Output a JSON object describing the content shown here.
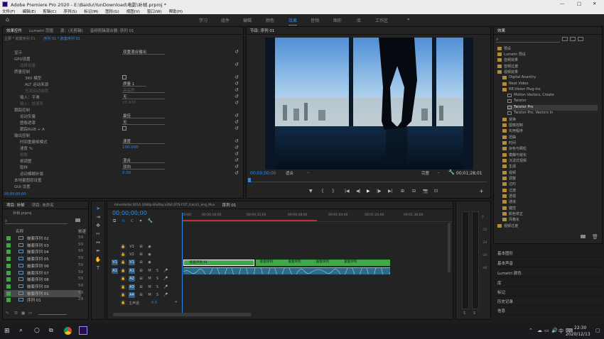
{
  "app": {
    "title": "Adobe Premiere Pro 2020 - E:\\Baidu\\YunDownload\\电影\\补帧.prproj *",
    "window_controls": [
      "—",
      "□",
      "✕"
    ]
  },
  "menu": [
    "文件(F)",
    "编辑(E)",
    "剪辑(C)",
    "序列(S)",
    "标记(M)",
    "图形(G)",
    "视图(V)",
    "窗口(W)",
    "帮助(H)"
  ],
  "workspaces": {
    "items": [
      "学习",
      "组件",
      "编辑",
      "颜色",
      "效果",
      "音频",
      "图形",
      "库",
      "工作区"
    ],
    "active": "效果",
    "more": "»"
  },
  "effect_controls": {
    "tabs": [
      "效果控件",
      "Lumetri 范围",
      "源：(无剪辑)",
      "音频剪辑混合器: 序列 01"
    ],
    "breadcrumb_master": "主要 * 嵌套序列 01",
    "breadcrumb_seq": "序列 01 * 嵌套序列 01",
    "rows": [
      {
        "label": "显示",
        "value": "双重混合输出",
        "type": "dropdown",
        "indent": 1
      },
      {
        "label": "GPU设置",
        "value": "",
        "type": "header",
        "indent": 1
      },
      {
        "label": "选择设备",
        "value": "",
        "type": "dim",
        "indent": 2
      },
      {
        "label": "质量控制",
        "value": "",
        "type": "header",
        "indent": 1
      },
      {
        "label": "360 模型",
        "value": "",
        "type": "check",
        "indent": 3
      },
      {
        "label": "ALT 运动来源",
        "value": "质量 1",
        "type": "dropdown",
        "indent": 3
      },
      {
        "label": "光流运动强度",
        "value": "高品质",
        "type": "dropdown-dim",
        "indent": 3
      },
      {
        "label": "输入：平滑",
        "value": "无",
        "type": "dropdown",
        "indent": 2
      },
      {
        "label": "输入：帧速率",
        "value": "23.976",
        "type": "dim",
        "indent": 2
      },
      {
        "label": "跟踪控制",
        "value": "",
        "type": "header",
        "indent": 1
      },
      {
        "label": "运动矢量",
        "value": "最佳",
        "type": "dropdown",
        "indent": 2
      },
      {
        "label": "图像遮罩",
        "value": "无",
        "type": "dropdown",
        "indent": 2
      },
      {
        "label": "跟踪RGB + A",
        "value": "",
        "type": "check",
        "indent": 2
      },
      {
        "label": "输出控制",
        "value": "",
        "type": "header",
        "indent": 1
      },
      {
        "label": "时间重建帧模式",
        "value": "速度",
        "type": "dropdown",
        "indent": 2
      },
      {
        "label": "速度 %",
        "value": "100.000",
        "type": "blue",
        "indent": 2
      },
      {
        "label": "帧数",
        "value": "",
        "type": "dim",
        "indent": 2
      },
      {
        "label": "帧调整",
        "value": "混合",
        "type": "dropdown",
        "indent": 2
      },
      {
        "label": "取样",
        "value": "双向",
        "type": "dropdown",
        "indent": 2
      },
      {
        "label": "运动模糊补偿",
        "value": "0.00",
        "type": "blue",
        "indent": 2
      },
      {
        "label": "本地量图层设置",
        "value": "",
        "type": "dim",
        "indent": 1
      },
      {
        "label": "GUI 设置",
        "value": "",
        "type": "dim",
        "indent": 1
      }
    ],
    "timecode": "00;00;00;00"
  },
  "program": {
    "tab": "节目: 序列 01",
    "timecode": "00;00;00;00",
    "fit": "适合",
    "quality": "完整",
    "duration": "00;01;28;01",
    "transport": [
      "▼",
      "{",
      "}",
      "|◀",
      "◀|",
      "▶",
      "|▶",
      "▶|",
      "⊞",
      "⊟",
      "📷",
      "⊡"
    ]
  },
  "effects": {
    "tab": "效果",
    "search_placeholder": "",
    "items": [
      {
        "label": "预设",
        "level": 0,
        "sel": false
      },
      {
        "label": "Lumetri 预设",
        "level": 0,
        "sel": false
      },
      {
        "label": "音频效果",
        "level": 0,
        "sel": false
      },
      {
        "label": "音频过渡",
        "level": 0,
        "sel": false
      },
      {
        "label": "视频效果",
        "level": 0,
        "sel": false
      },
      {
        "label": "Digital Anarchy",
        "level": 1,
        "sel": false
      },
      {
        "label": "Neat Video",
        "level": 1,
        "sel": false
      },
      {
        "label": "RE:Vision Plug-ins",
        "level": 1,
        "sel": false
      },
      {
        "label": "Motion Vectors, Create",
        "level": 2,
        "sel": false
      },
      {
        "label": "Twixtor",
        "level": 2,
        "sel": false
      },
      {
        "label": "Twixtor Pro",
        "level": 2,
        "sel": true
      },
      {
        "label": "Twixtor Pro, Vectors In",
        "level": 2,
        "sel": false
      },
      {
        "label": "变换",
        "level": 1,
        "sel": false
      },
      {
        "label": "图像控制",
        "level": 1,
        "sel": false
      },
      {
        "label": "实用程序",
        "level": 1,
        "sel": false
      },
      {
        "label": "扭曲",
        "level": 1,
        "sel": false
      },
      {
        "label": "时间",
        "level": 1,
        "sel": false
      },
      {
        "label": "杂色与颗粒",
        "level": 1,
        "sel": false
      },
      {
        "label": "模糊与锐化",
        "level": 1,
        "sel": false
      },
      {
        "label": "沉浸式视频",
        "level": 1,
        "sel": false
      },
      {
        "label": "生成",
        "level": 1,
        "sel": false
      },
      {
        "label": "视频",
        "level": 1,
        "sel": false
      },
      {
        "label": "调整",
        "level": 1,
        "sel": false
      },
      {
        "label": "过时",
        "level": 1,
        "sel": false
      },
      {
        "label": "过渡",
        "level": 1,
        "sel": false
      },
      {
        "label": "透视",
        "level": 1,
        "sel": false
      },
      {
        "label": "通道",
        "level": 1,
        "sel": false
      },
      {
        "label": "键控",
        "level": 1,
        "sel": false
      },
      {
        "label": "颜色校正",
        "level": 1,
        "sel": false
      },
      {
        "label": "风格化",
        "level": 1,
        "sel": false
      },
      {
        "label": "视频过渡",
        "level": 0,
        "sel": false
      }
    ]
  },
  "side_panels": [
    "基本图形",
    "基本声音",
    "Lumetri 颜色",
    "库",
    "标记",
    "历史记录",
    "信息"
  ],
  "project": {
    "tabs": [
      "项目: 补帧",
      "项目: 未命名"
    ],
    "file": "补帧.prproj",
    "col_name": "名称",
    "col_rate": "帧速",
    "items": [
      {
        "name": "嵌套序列 02",
        "rate": "59"
      },
      {
        "name": "嵌套序列 03",
        "rate": "59"
      },
      {
        "name": "嵌套序列 04",
        "rate": "59"
      },
      {
        "name": "嵌套序列 05",
        "rate": "59"
      },
      {
        "name": "嵌套序列 06",
        "rate": "59"
      },
      {
        "name": "嵌套序列 07",
        "rate": "59"
      },
      {
        "name": "嵌套序列 08",
        "rate": "59"
      },
      {
        "name": "嵌套序列 09",
        "rate": "59"
      },
      {
        "name": "嵌套序列 01",
        "rate": "59"
      },
      {
        "name": "序列 01",
        "rate": "29"
      }
    ]
  },
  "timeline": {
    "tabs": [
      "Interstellar.2014.1080p.BluRay.x264.DTS-FGT_track1_eng_Mux",
      "序列 01"
    ],
    "timecode": "00;00;00;00",
    "ruler": [
      "00;00",
      "00;00;16;00",
      "00;00;32;00",
      "00;00;48;00",
      "00;01;04;00",
      "00;01;20;00",
      "00;01;36;00"
    ],
    "video_tracks": [
      "V3",
      "V2",
      "V1"
    ],
    "audio_tracks": [
      "A1",
      "A2",
      "A3",
      "A4"
    ],
    "master": "主声道",
    "master_val": "0.0",
    "clip_first": "嵌套序列 01",
    "clip_label": "嵌套序列"
  },
  "meter_db": [
    "0",
    "-12",
    "-24",
    "-36",
    "-48"
  ],
  "meter_solo": [
    "S",
    "S"
  ],
  "taskbar": {
    "time": "22:30",
    "date": "2020/12/13",
    "ime": "中"
  }
}
